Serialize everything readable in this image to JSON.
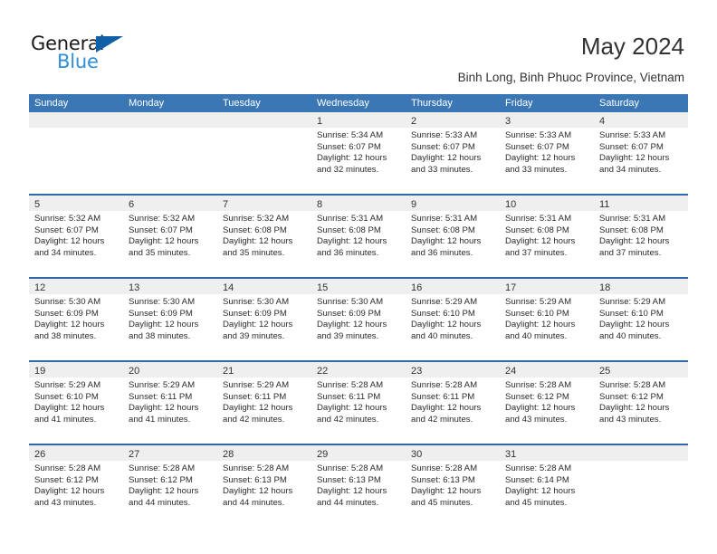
{
  "brand": {
    "name_top": "General",
    "name_bottom": "Blue",
    "triangle_icon": "triangle-icon",
    "accent_dark": "#1060a8",
    "accent_light": "#2f8fd8"
  },
  "header": {
    "title": "May 2024",
    "subtitle": "Binh Long, Binh Phuoc Province, Vietnam"
  },
  "colors": {
    "header_blue": "#3b77b4",
    "row_divider": "#2d6ca8",
    "day_band": "#efefef"
  },
  "calendar": {
    "weekdays": [
      "Sunday",
      "Monday",
      "Tuesday",
      "Wednesday",
      "Thursday",
      "Friday",
      "Saturday"
    ],
    "weeks": [
      [
        {
          "day": "",
          "empty": true
        },
        {
          "day": "",
          "empty": true
        },
        {
          "day": "",
          "empty": true
        },
        {
          "day": "1",
          "sunrise": "Sunrise: 5:34 AM",
          "sunset": "Sunset: 6:07 PM",
          "daylight_1": "Daylight: 12 hours",
          "daylight_2": "and 32 minutes."
        },
        {
          "day": "2",
          "sunrise": "Sunrise: 5:33 AM",
          "sunset": "Sunset: 6:07 PM",
          "daylight_1": "Daylight: 12 hours",
          "daylight_2": "and 33 minutes."
        },
        {
          "day": "3",
          "sunrise": "Sunrise: 5:33 AM",
          "sunset": "Sunset: 6:07 PM",
          "daylight_1": "Daylight: 12 hours",
          "daylight_2": "and 33 minutes."
        },
        {
          "day": "4",
          "sunrise": "Sunrise: 5:33 AM",
          "sunset": "Sunset: 6:07 PM",
          "daylight_1": "Daylight: 12 hours",
          "daylight_2": "and 34 minutes."
        }
      ],
      [
        {
          "day": "5",
          "sunrise": "Sunrise: 5:32 AM",
          "sunset": "Sunset: 6:07 PM",
          "daylight_1": "Daylight: 12 hours",
          "daylight_2": "and 34 minutes."
        },
        {
          "day": "6",
          "sunrise": "Sunrise: 5:32 AM",
          "sunset": "Sunset: 6:07 PM",
          "daylight_1": "Daylight: 12 hours",
          "daylight_2": "and 35 minutes."
        },
        {
          "day": "7",
          "sunrise": "Sunrise: 5:32 AM",
          "sunset": "Sunset: 6:08 PM",
          "daylight_1": "Daylight: 12 hours",
          "daylight_2": "and 35 minutes."
        },
        {
          "day": "8",
          "sunrise": "Sunrise: 5:31 AM",
          "sunset": "Sunset: 6:08 PM",
          "daylight_1": "Daylight: 12 hours",
          "daylight_2": "and 36 minutes."
        },
        {
          "day": "9",
          "sunrise": "Sunrise: 5:31 AM",
          "sunset": "Sunset: 6:08 PM",
          "daylight_1": "Daylight: 12 hours",
          "daylight_2": "and 36 minutes."
        },
        {
          "day": "10",
          "sunrise": "Sunrise: 5:31 AM",
          "sunset": "Sunset: 6:08 PM",
          "daylight_1": "Daylight: 12 hours",
          "daylight_2": "and 37 minutes."
        },
        {
          "day": "11",
          "sunrise": "Sunrise: 5:31 AM",
          "sunset": "Sunset: 6:08 PM",
          "daylight_1": "Daylight: 12 hours",
          "daylight_2": "and 37 minutes."
        }
      ],
      [
        {
          "day": "12",
          "sunrise": "Sunrise: 5:30 AM",
          "sunset": "Sunset: 6:09 PM",
          "daylight_1": "Daylight: 12 hours",
          "daylight_2": "and 38 minutes."
        },
        {
          "day": "13",
          "sunrise": "Sunrise: 5:30 AM",
          "sunset": "Sunset: 6:09 PM",
          "daylight_1": "Daylight: 12 hours",
          "daylight_2": "and 38 minutes."
        },
        {
          "day": "14",
          "sunrise": "Sunrise: 5:30 AM",
          "sunset": "Sunset: 6:09 PM",
          "daylight_1": "Daylight: 12 hours",
          "daylight_2": "and 39 minutes."
        },
        {
          "day": "15",
          "sunrise": "Sunrise: 5:30 AM",
          "sunset": "Sunset: 6:09 PM",
          "daylight_1": "Daylight: 12 hours",
          "daylight_2": "and 39 minutes."
        },
        {
          "day": "16",
          "sunrise": "Sunrise: 5:29 AM",
          "sunset": "Sunset: 6:10 PM",
          "daylight_1": "Daylight: 12 hours",
          "daylight_2": "and 40 minutes."
        },
        {
          "day": "17",
          "sunrise": "Sunrise: 5:29 AM",
          "sunset": "Sunset: 6:10 PM",
          "daylight_1": "Daylight: 12 hours",
          "daylight_2": "and 40 minutes."
        },
        {
          "day": "18",
          "sunrise": "Sunrise: 5:29 AM",
          "sunset": "Sunset: 6:10 PM",
          "daylight_1": "Daylight: 12 hours",
          "daylight_2": "and 40 minutes."
        }
      ],
      [
        {
          "day": "19",
          "sunrise": "Sunrise: 5:29 AM",
          "sunset": "Sunset: 6:10 PM",
          "daylight_1": "Daylight: 12 hours",
          "daylight_2": "and 41 minutes."
        },
        {
          "day": "20",
          "sunrise": "Sunrise: 5:29 AM",
          "sunset": "Sunset: 6:11 PM",
          "daylight_1": "Daylight: 12 hours",
          "daylight_2": "and 41 minutes."
        },
        {
          "day": "21",
          "sunrise": "Sunrise: 5:29 AM",
          "sunset": "Sunset: 6:11 PM",
          "daylight_1": "Daylight: 12 hours",
          "daylight_2": "and 42 minutes."
        },
        {
          "day": "22",
          "sunrise": "Sunrise: 5:28 AM",
          "sunset": "Sunset: 6:11 PM",
          "daylight_1": "Daylight: 12 hours",
          "daylight_2": "and 42 minutes."
        },
        {
          "day": "23",
          "sunrise": "Sunrise: 5:28 AM",
          "sunset": "Sunset: 6:11 PM",
          "daylight_1": "Daylight: 12 hours",
          "daylight_2": "and 42 minutes."
        },
        {
          "day": "24",
          "sunrise": "Sunrise: 5:28 AM",
          "sunset": "Sunset: 6:12 PM",
          "daylight_1": "Daylight: 12 hours",
          "daylight_2": "and 43 minutes."
        },
        {
          "day": "25",
          "sunrise": "Sunrise: 5:28 AM",
          "sunset": "Sunset: 6:12 PM",
          "daylight_1": "Daylight: 12 hours",
          "daylight_2": "and 43 minutes."
        }
      ],
      [
        {
          "day": "26",
          "sunrise": "Sunrise: 5:28 AM",
          "sunset": "Sunset: 6:12 PM",
          "daylight_1": "Daylight: 12 hours",
          "daylight_2": "and 43 minutes."
        },
        {
          "day": "27",
          "sunrise": "Sunrise: 5:28 AM",
          "sunset": "Sunset: 6:12 PM",
          "daylight_1": "Daylight: 12 hours",
          "daylight_2": "and 44 minutes."
        },
        {
          "day": "28",
          "sunrise": "Sunrise: 5:28 AM",
          "sunset": "Sunset: 6:13 PM",
          "daylight_1": "Daylight: 12 hours",
          "daylight_2": "and 44 minutes."
        },
        {
          "day": "29",
          "sunrise": "Sunrise: 5:28 AM",
          "sunset": "Sunset: 6:13 PM",
          "daylight_1": "Daylight: 12 hours",
          "daylight_2": "and 44 minutes."
        },
        {
          "day": "30",
          "sunrise": "Sunrise: 5:28 AM",
          "sunset": "Sunset: 6:13 PM",
          "daylight_1": "Daylight: 12 hours",
          "daylight_2": "and 45 minutes."
        },
        {
          "day": "31",
          "sunrise": "Sunrise: 5:28 AM",
          "sunset": "Sunset: 6:14 PM",
          "daylight_1": "Daylight: 12 hours",
          "daylight_2": "and 45 minutes."
        },
        {
          "day": "",
          "empty": true
        }
      ]
    ]
  }
}
